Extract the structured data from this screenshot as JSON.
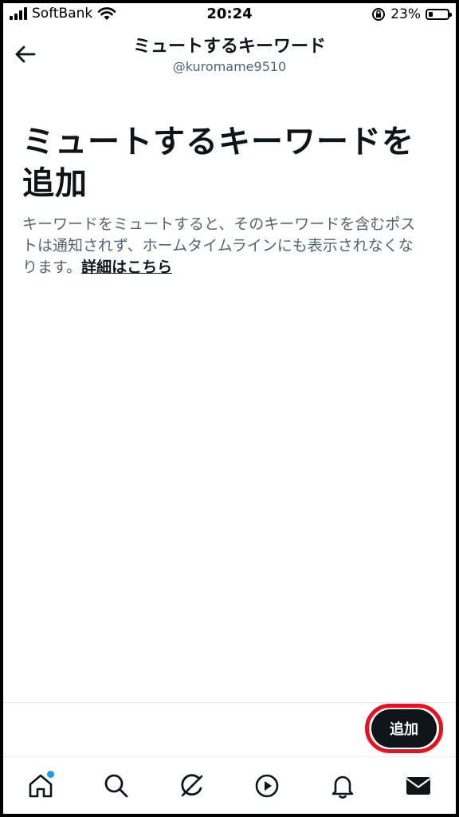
{
  "status_bar": {
    "carrier": "SoftBank",
    "time": "20:24",
    "battery_percent": "23%",
    "battery_level": 0.23,
    "icons": [
      "signal-icon",
      "wifi-icon",
      "orientation-lock-icon",
      "battery-icon"
    ]
  },
  "header": {
    "title": "ミュートするキーワード",
    "username": "@kuromame9510",
    "back_icon": "arrow-left-icon"
  },
  "main": {
    "heading_line1": "ミュートするキーワードを",
    "heading_line2": "追加",
    "description": "キーワードをミュートすると、そのキーワードを含むポストは通知されず、ホームタイムラインにも表示されなくなります。",
    "learn_more": "詳細はこちら"
  },
  "action": {
    "add_label": "追加",
    "highlight_color": "#e8101f"
  },
  "tabbar": {
    "items": [
      {
        "icon": "home-icon",
        "has_notification_dot": true
      },
      {
        "icon": "search-icon"
      },
      {
        "icon": "grok-icon"
      },
      {
        "icon": "play-icon"
      },
      {
        "icon": "bell-icon"
      },
      {
        "icon": "mail-icon"
      }
    ]
  },
  "colors": {
    "text_primary": "#0f1419",
    "text_secondary": "#536471",
    "accent_dot": "#1d9bf0"
  }
}
